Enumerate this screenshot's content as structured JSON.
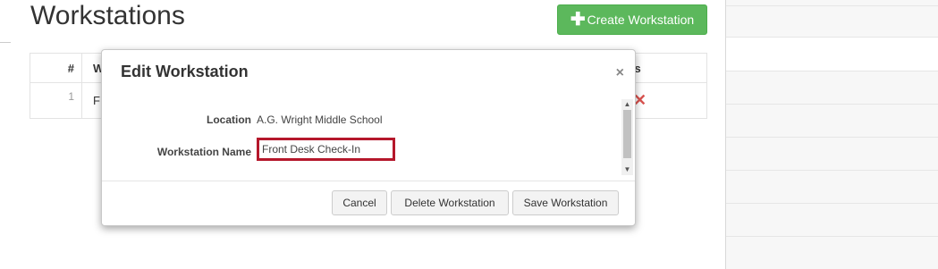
{
  "page": {
    "title": "Workstations"
  },
  "toolbar": {
    "create_label": "Create Workstation",
    "create_icon": "plus-icon"
  },
  "table": {
    "headers": {
      "num": "#",
      "name": "W",
      "tools": "Tools"
    },
    "rows": [
      {
        "num": "1",
        "name": "F"
      }
    ]
  },
  "modal": {
    "title": "Edit Workstation",
    "close": "×",
    "fields": {
      "location_label": "Location",
      "location_value": "A.G. Wright Middle School",
      "name_label": "Workstation Name",
      "name_value": "Front Desk Check-In"
    },
    "buttons": {
      "cancel": "Cancel",
      "delete": "Delete Workstation",
      "save": "Save Workstation"
    }
  },
  "colors": {
    "primary_green": "#5cb85c",
    "highlight_red": "#b5172b",
    "delete_red": "#d9534f"
  }
}
